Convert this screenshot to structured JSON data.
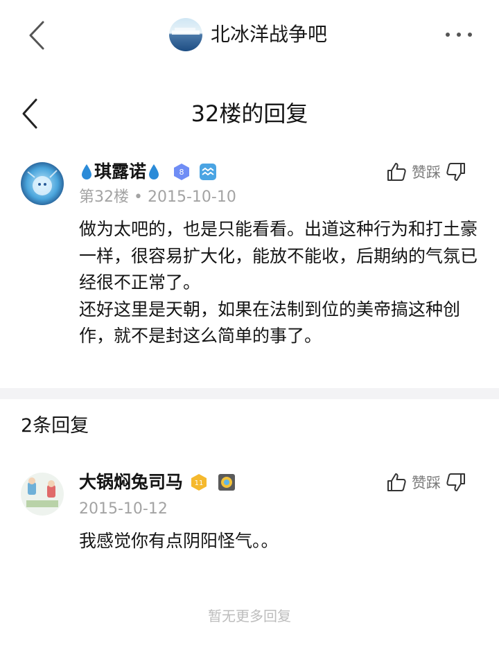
{
  "topbar": {
    "forum_name": "北冰洋战争吧",
    "back_icon": "chevron-left-icon",
    "more_icon": "more-dots-icon"
  },
  "subheader": {
    "title": "32楼的回复"
  },
  "post": {
    "username": "琪露诺",
    "level": "8",
    "floor_date": "第32楼 • 2015-10-10",
    "vote_label": "赞踩",
    "paragraphs": [
      "做为太吧的，也是只能看看。出道这种行为和打土豪一样，很容易扩大化，能放不能收，后期纳的气氛已经很不正常了。",
      "还好这里是天朝，如果在法制到位的美帝搞这种创作，就不是封这么简单的事了。"
    ]
  },
  "replies": {
    "count_title": "2条回复",
    "items": [
      {
        "username": "大锅焖兔司马",
        "level": "11",
        "date": "2015-10-12",
        "vote_label": "赞踩",
        "text": "我感觉你有点阴阳怪气。。"
      }
    ],
    "no_more": "暂无更多回复"
  },
  "colors": {
    "meta_gray": "#a3a3a3",
    "divider": "#f3f3f5",
    "level_badge_blue": "#6f8df5",
    "level_badge_gold": "#f5b92e",
    "drop_blue": "#2b8bd8"
  }
}
